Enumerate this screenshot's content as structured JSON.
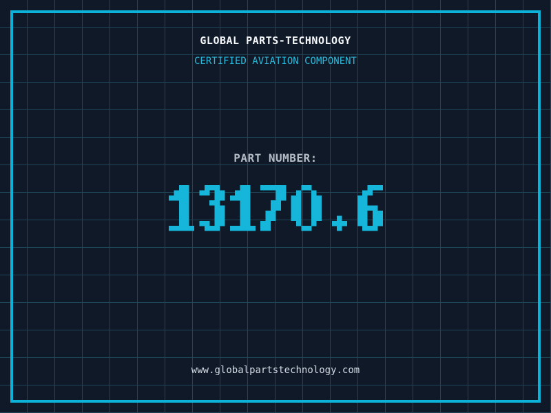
{
  "header": {
    "title": "GLOBAL PARTS-TECHNOLOGY",
    "subtitle": "CERTIFIED AVIATION COMPONENT"
  },
  "part": {
    "label": "PART NUMBER:",
    "value": "13170.6"
  },
  "footer": {
    "url": "www.globalpartstechnology.com"
  },
  "colors": {
    "background": "#0f1928",
    "grid_line": "#1d4656",
    "frame": "#0cb2d8",
    "digit_cyan": "#15b6da",
    "subtitle_cyan": "#2bb9db",
    "title_text": "#f4f6f8",
    "label_text": "#b4bcc6",
    "url_text": "#d3dbe4"
  }
}
